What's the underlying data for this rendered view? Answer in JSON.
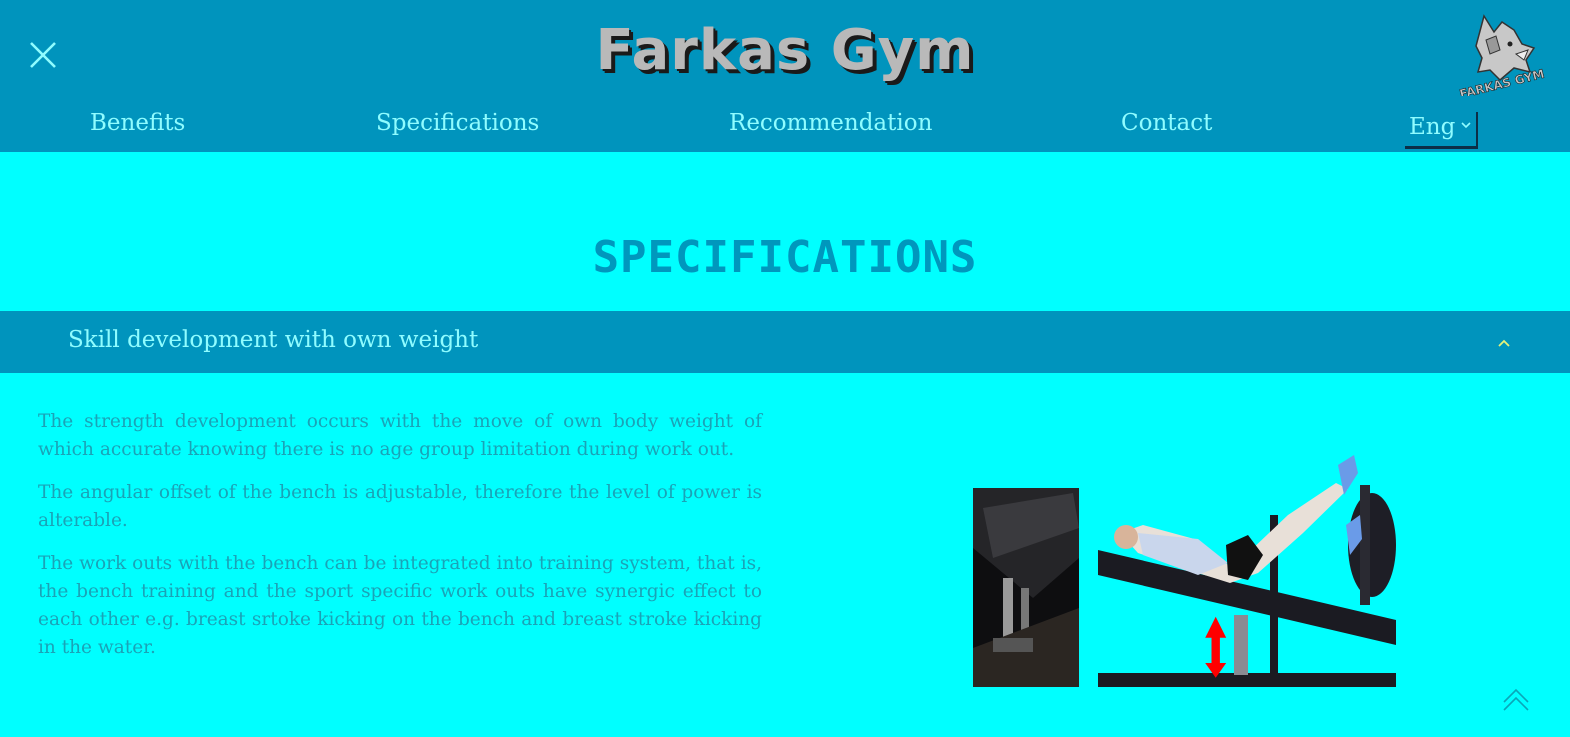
{
  "header": {
    "brand": "Farkas Gym",
    "logo_text": "FARKAS GYM",
    "menu_icon": "close-icon",
    "nav": [
      {
        "label": "Benefits"
      },
      {
        "label": "Specifications"
      },
      {
        "label": "Recommendation"
      },
      {
        "label": "Contact"
      }
    ],
    "language": {
      "selected": "Eng",
      "icon": "chevron-down-icon"
    }
  },
  "section": {
    "title": "SPECIFICATIONS",
    "accordion": {
      "title": "Skill development with own weight",
      "icon": "chevron-up-icon",
      "expanded": true
    },
    "paragraphs": [
      "The strength development occurs with the move of own body weight of which accurate knowing there is no age group limitation during work out.",
      "The angular offset of the bench is adjustable, therefore the level of power is alterable.",
      "The work outs with the bench can be integrated into training system, that is, the bench training and the sport specific work outs have synergic effect to each other e.g. breast srtoke kicking on the bench and breast stroke kicking in the water."
    ]
  },
  "scroll_top_icon": "double-chevron-up-icon",
  "colors": {
    "header_bg": "#0094bd",
    "page_bg": "#00ffff",
    "nav_text": "#8ffcff",
    "title": "#0097bd",
    "body_text": "#1aa3b7",
    "arrow": "#ff0000"
  }
}
